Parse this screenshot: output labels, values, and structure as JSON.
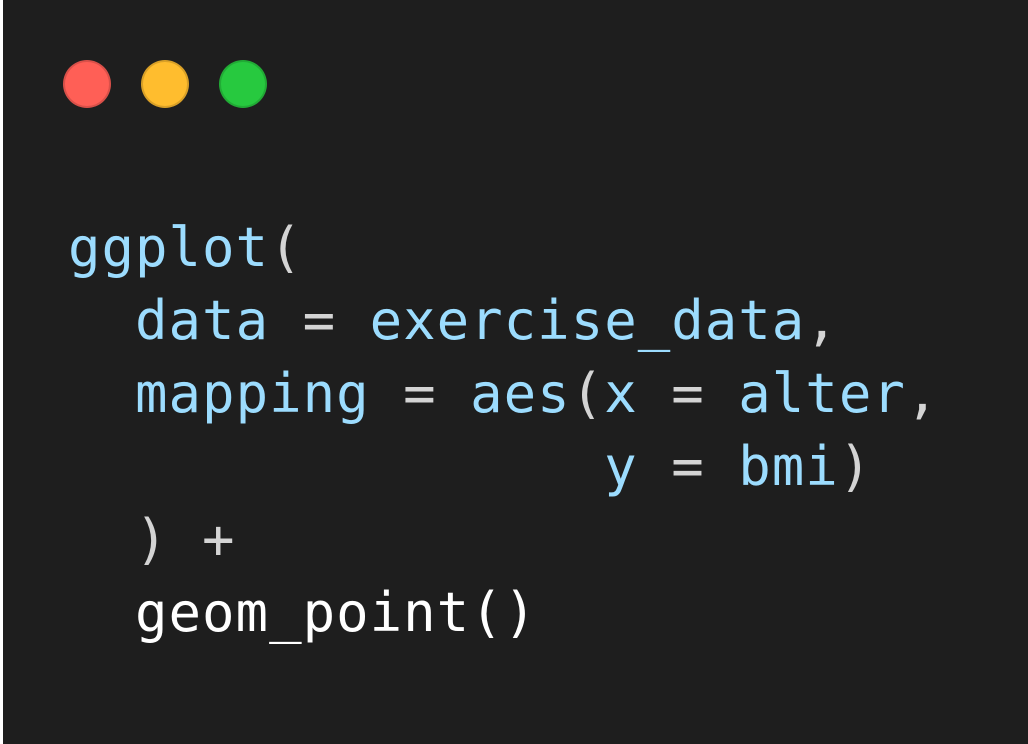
{
  "colors": {
    "background": "#1e1e1e",
    "identifier": "#9cdcfe",
    "punctuation": "#d4d4d4",
    "function_plain": "#ffffff",
    "close": "#ff5f56",
    "minimize": "#ffbd2e",
    "maximize": "#27c93f"
  },
  "window_controls": [
    "close",
    "minimize",
    "maximize"
  ],
  "code_lines": [
    [
      {
        "t": "ggplot",
        "k": "identifier"
      },
      {
        "t": "(",
        "k": "punctuation"
      }
    ],
    [
      {
        "t": "  ",
        "k": "punctuation"
      },
      {
        "t": "data",
        "k": "identifier"
      },
      {
        "t": " = ",
        "k": "punctuation"
      },
      {
        "t": "exercise_data",
        "k": "identifier"
      },
      {
        "t": ",",
        "k": "punctuation"
      }
    ],
    [
      {
        "t": "  ",
        "k": "punctuation"
      },
      {
        "t": "mapping",
        "k": "identifier"
      },
      {
        "t": " = ",
        "k": "punctuation"
      },
      {
        "t": "aes",
        "k": "identifier"
      },
      {
        "t": "(",
        "k": "punctuation"
      },
      {
        "t": "x",
        "k": "identifier"
      },
      {
        "t": " = ",
        "k": "punctuation"
      },
      {
        "t": "alter",
        "k": "identifier"
      },
      {
        "t": ",",
        "k": "punctuation"
      }
    ],
    [
      {
        "t": "                ",
        "k": "punctuation"
      },
      {
        "t": "y",
        "k": "identifier"
      },
      {
        "t": " = ",
        "k": "punctuation"
      },
      {
        "t": "bmi",
        "k": "identifier"
      },
      {
        "t": ")",
        "k": "punctuation"
      }
    ],
    [
      {
        "t": "  ) +",
        "k": "punctuation"
      }
    ],
    [
      {
        "t": "  geom_point()",
        "k": "function_plain"
      }
    ]
  ]
}
